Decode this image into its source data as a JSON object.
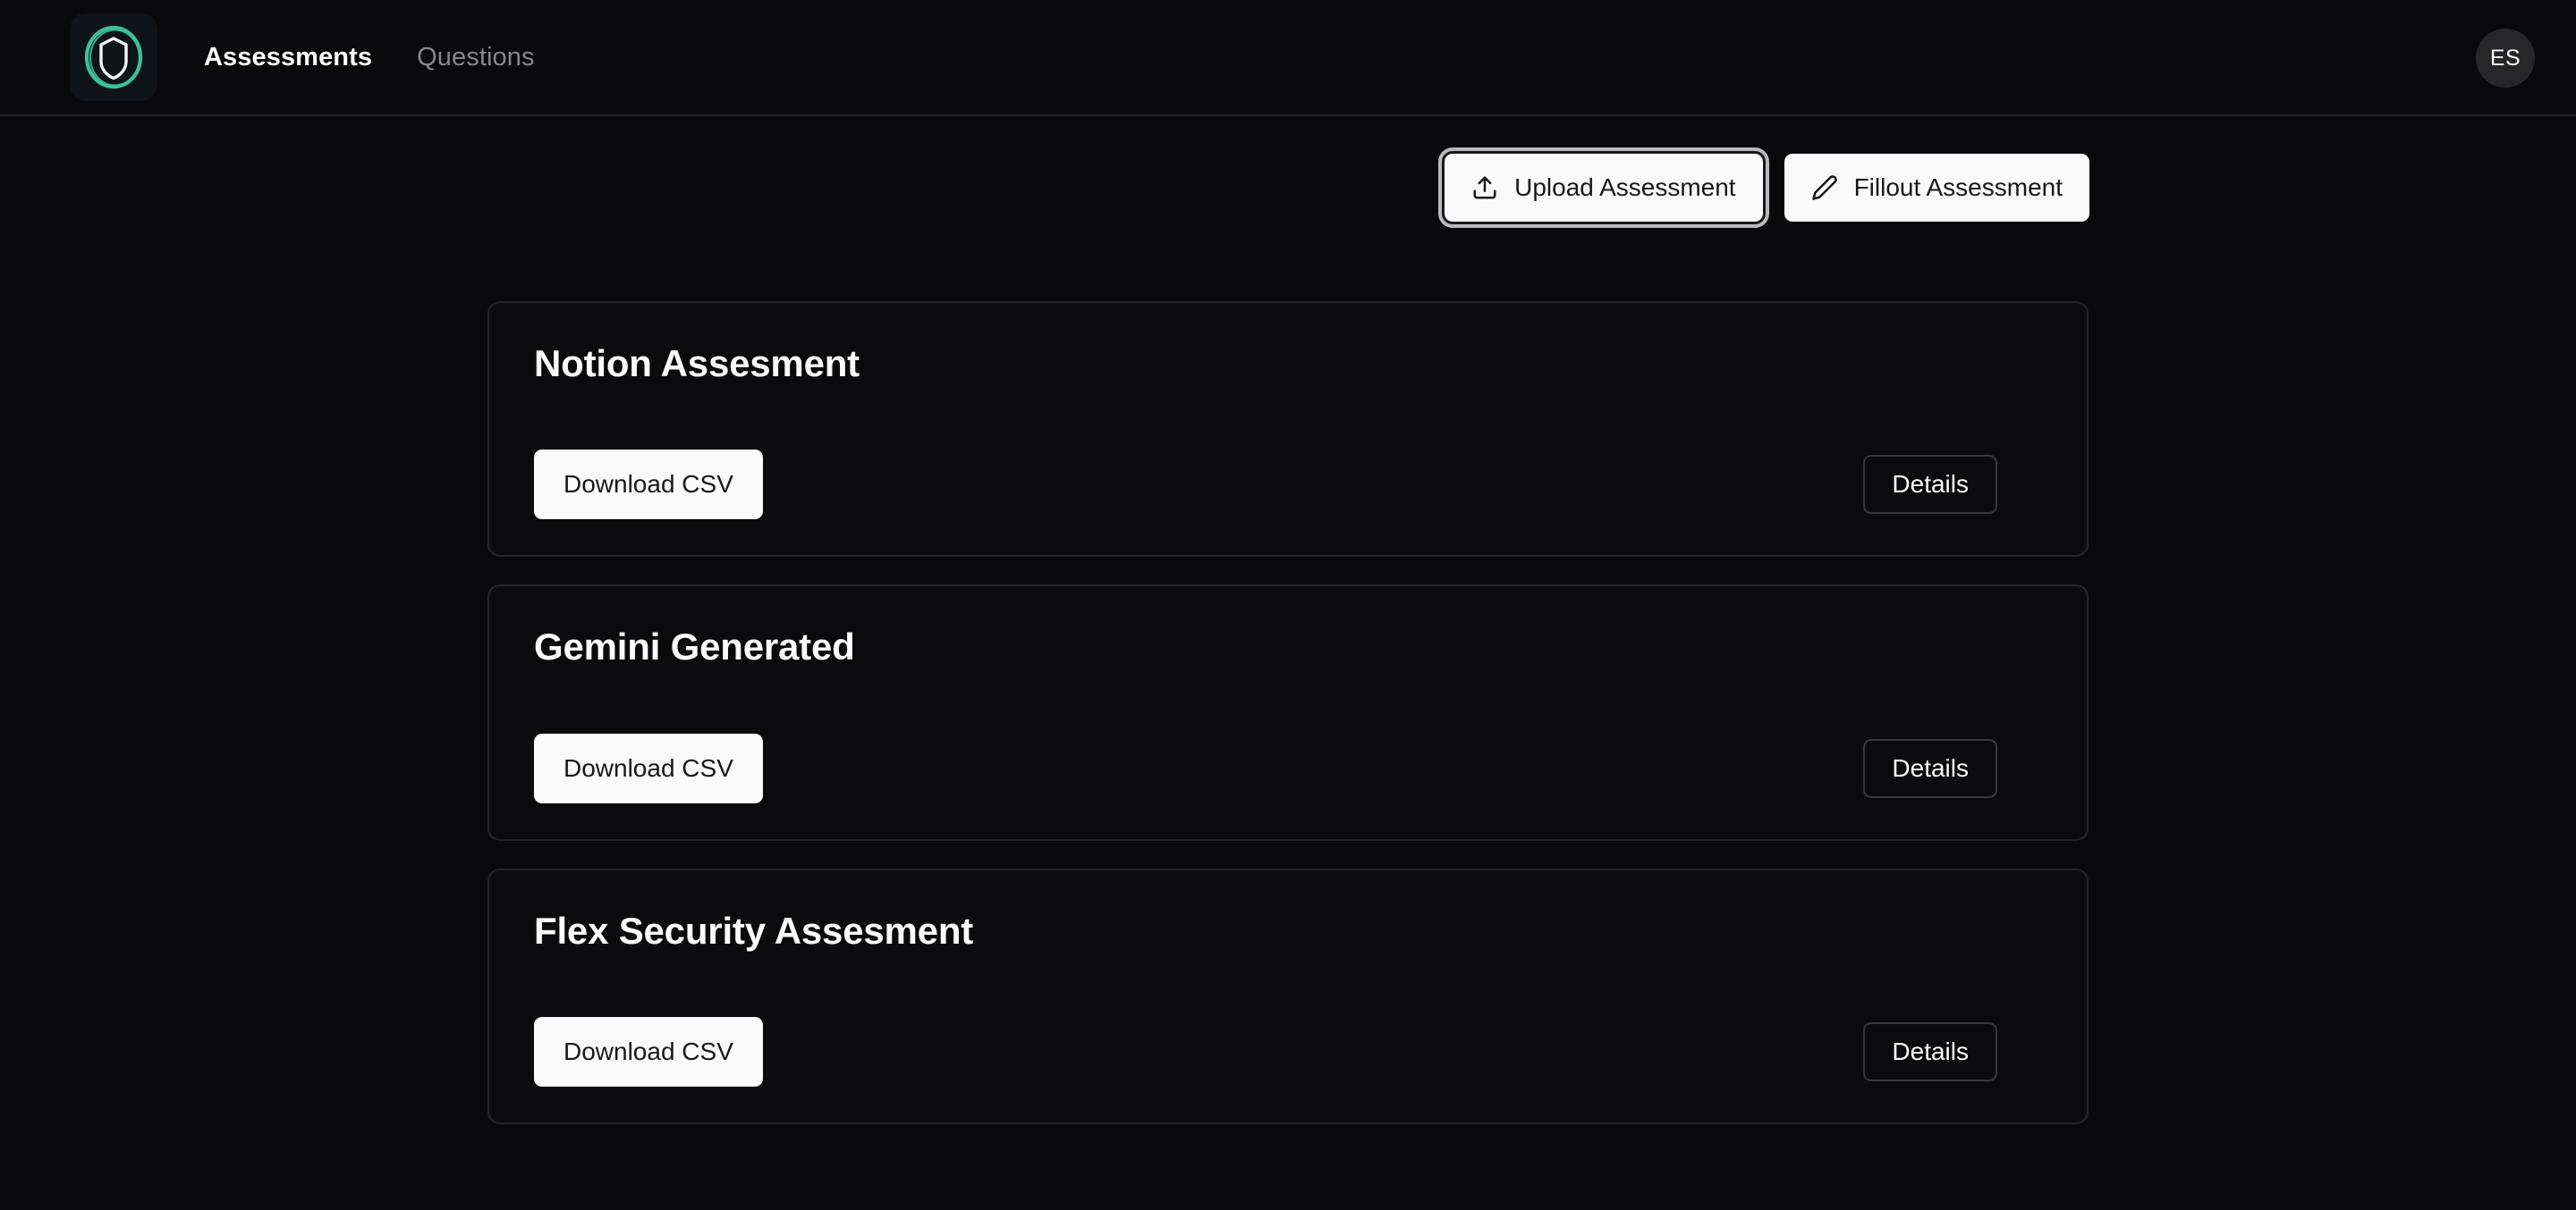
{
  "header": {
    "logo": {
      "icon": "shield-logo-icon",
      "ring_color": "#3fbf9a",
      "shield_color": "#f4f7f7",
      "tile_color": "#0f1419"
    },
    "nav": [
      {
        "label": "Assessments",
        "state": "active",
        "name": "nav-link-assessments"
      },
      {
        "label": "Questions",
        "state": "muted",
        "name": "nav-link-questions"
      }
    ],
    "avatar": {
      "initials": "ES",
      "name": "user-avatar"
    }
  },
  "toolbar": {
    "upload_label": "Upload Assessment",
    "upload_icon": "upload-icon",
    "upload_focused": true,
    "fillout_label": "Fillout Assessment",
    "fillout_icon": "pencil-icon"
  },
  "assessments": [
    {
      "title": "Notion Assesment",
      "download_label": "Download CSV",
      "details_label": "Details"
    },
    {
      "title": "Gemini Generated",
      "download_label": "Download CSV",
      "details_label": "Details"
    },
    {
      "title": "Flex Security Assesment",
      "download_label": "Download CSV",
      "details_label": "Details"
    }
  ],
  "colors": {
    "page_bg": "#09090b",
    "card_bg": "#0b0b0e",
    "card_border": "#252528",
    "accent_teal": "#3fbf9a",
    "light_button": "#fafafa",
    "muted_text": "#86868c"
  }
}
